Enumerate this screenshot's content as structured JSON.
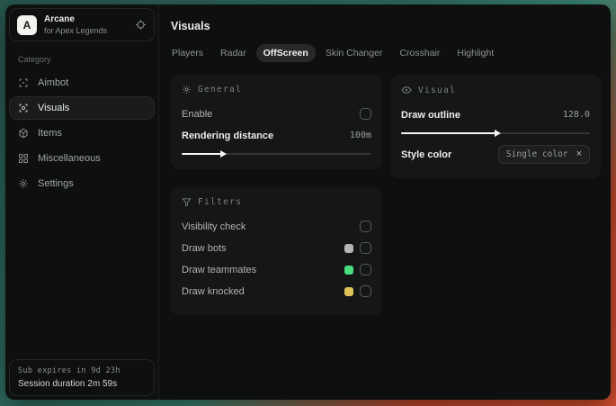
{
  "app": {
    "name": "Arcane",
    "subtitle": "for Apex Legends",
    "logo_letter": "A"
  },
  "sidebar": {
    "category_label": "Category",
    "items": [
      {
        "label": "Aimbot",
        "icon": "aimbot-crosshair"
      },
      {
        "label": "Visuals",
        "icon": "visuals-eye-scan",
        "selected": true
      },
      {
        "label": "Items",
        "icon": "items-cube"
      },
      {
        "label": "Miscellaneous",
        "icon": "misc-grid"
      },
      {
        "label": "Settings",
        "icon": "settings-gear"
      }
    ],
    "footer": {
      "sub_expires": "Sub expires in 9d 23h",
      "session_duration": "Session duration 2m 59s"
    }
  },
  "main": {
    "title": "Visuals",
    "tabs": [
      {
        "label": "Players",
        "selected": false
      },
      {
        "label": "Radar",
        "selected": false
      },
      {
        "label": "OffScreen",
        "selected": true
      },
      {
        "label": "Skin Changer",
        "selected": false
      },
      {
        "label": "Crosshair",
        "selected": false
      },
      {
        "label": "Highlight",
        "selected": false
      }
    ],
    "general_panel": {
      "title": "General",
      "enable_label": "Enable",
      "enable_checked": false,
      "rendering_distance_label": "Rendering distance",
      "rendering_distance_value": "100m",
      "rendering_distance_percent": 21
    },
    "visual_panel": {
      "title": "Visual",
      "draw_outline_label": "Draw outline",
      "draw_outline_value": "128.0",
      "draw_outline_percent": 50,
      "style_color_label": "Style color",
      "style_color_selected": "Single color",
      "style_color_remove": "×"
    },
    "filters_panel": {
      "title": "Filters",
      "rows": [
        {
          "label": "Visibility check",
          "checked": false
        },
        {
          "label": "Draw bots",
          "swatch": "#b5b6b4",
          "checked": false
        },
        {
          "label": "Draw teammates",
          "swatch": "#4ade80",
          "checked": false
        },
        {
          "label": "Draw knocked",
          "swatch": "#dfc257",
          "checked": false
        }
      ]
    }
  },
  "colors": {
    "bg_teal": "#2f6e62",
    "bg_orange": "#c94a2e",
    "panel_bg": "#151716",
    "swatch_gray": "#b5b6b4",
    "swatch_green": "#4ade80",
    "swatch_yellow": "#dfc257"
  }
}
